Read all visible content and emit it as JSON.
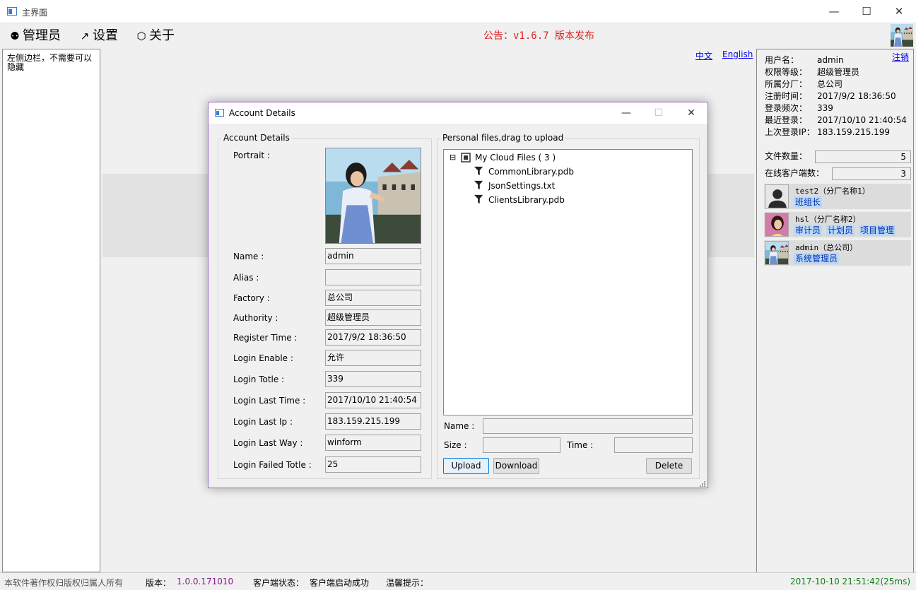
{
  "window": {
    "title": "主界面",
    "minimize": "—",
    "maximize": "☐",
    "close": "✕"
  },
  "menu": {
    "items": [
      {
        "icon": "users-icon",
        "glyph": "⚉",
        "label": "管理员"
      },
      {
        "icon": "arrow-icon",
        "glyph": "↗",
        "label": "设置"
      },
      {
        "icon": "cube-icon",
        "glyph": "⬡",
        "label": "关于"
      }
    ],
    "notice": "公告：v1.6.7 版本发布"
  },
  "left_sidebar": {
    "text": "左侧边栏，不需要可以隐藏"
  },
  "language": {
    "zh": "中文",
    "en": "English"
  },
  "right_panel": {
    "logout": "注销",
    "info": [
      {
        "label": "用户名：",
        "value": "admin"
      },
      {
        "label": "权限等级：",
        "value": "超级管理员"
      },
      {
        "label": "所属分厂：",
        "value": "总公司"
      },
      {
        "label": "注册时间：",
        "value": "2017/9/2 18:36:50"
      },
      {
        "label": "登录频次：",
        "value": "339"
      },
      {
        "label": "最近登录：",
        "value": "2017/10/10 21:40:54"
      },
      {
        "label": "上次登录IP：",
        "value": "183.159.215.199"
      }
    ],
    "file_count_label": "文件数量：",
    "file_count": "5",
    "online_label": "在线客户端数：",
    "online_count": "3",
    "clients": [
      {
        "name": "test2（分厂名称1）",
        "roles": [
          "班组长"
        ]
      },
      {
        "name": "hsl（分厂名称2）",
        "roles": [
          "审计员",
          "计划员",
          "项目管理"
        ]
      },
      {
        "name": "admin（总公司）",
        "roles": [
          "系统管理员"
        ]
      }
    ]
  },
  "dialog": {
    "title": "Account Details",
    "minimize": "—",
    "maximize": "☐",
    "close": "✕",
    "account_group": "Account Details",
    "portrait_label": "Portrait :",
    "fields": [
      {
        "label": "Name :",
        "value": "admin"
      },
      {
        "label": "Alias :",
        "value": ""
      },
      {
        "label": "Factory :",
        "value": "总公司"
      },
      {
        "label": "Authority :",
        "value": "超级管理员"
      },
      {
        "label": "Register Time :",
        "value": "2017/9/2 18:36:50"
      },
      {
        "label": "Login Enable :",
        "value": "允许"
      },
      {
        "label": "Login Totle :",
        "value": "339"
      },
      {
        "label": "Login Last Time :",
        "value": "2017/10/10 21:40:54"
      },
      {
        "label": "Login Last Ip :",
        "value": "183.159.215.199"
      },
      {
        "label": "Login Last Way :",
        "value": "winform"
      },
      {
        "label": "Login Failed Totle :",
        "value": "25"
      }
    ],
    "files_group": "Personal files,drag to upload",
    "tree": {
      "toggle": "⊟",
      "root": "My Cloud Files ( 3 )",
      "files": [
        "CommonLibrary.pdb",
        "JsonSettings.txt",
        "ClientsLibrary.pdb"
      ]
    },
    "name_label": "Name :",
    "size_label": "Size :",
    "time_label": "Time :",
    "upload": "Upload",
    "download": "Download",
    "delete": "Delete"
  },
  "status": {
    "copyright": "本软件著作权归版权归属人所有",
    "version_label": "版本：",
    "version": "1.0.0.171010",
    "client_state_label": "客户端状态：",
    "client_state": "客户端启动成功",
    "tip_label": "温馨提示：",
    "clock": "2017-10-10 21:51:42(25ms)"
  },
  "colors": {
    "notice": "#e02020",
    "version": "#8b1a8b",
    "clock": "#108010",
    "link": "#0000ee",
    "role_bg": "#bcd8f5",
    "dialog_border": "#9b6fc6"
  }
}
